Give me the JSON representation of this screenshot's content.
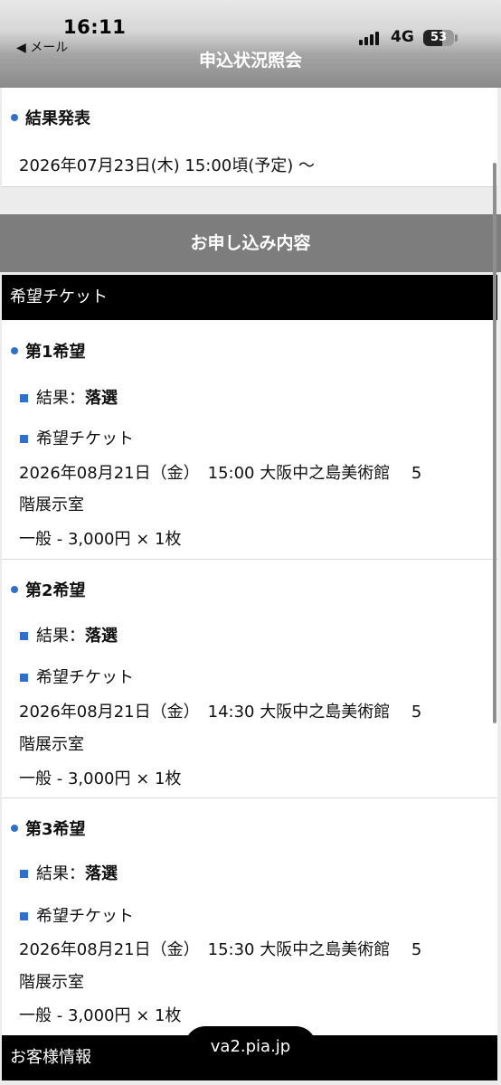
{
  "status_bar": {
    "time": "16:11",
    "back_label": "◀ メール",
    "network": "4G",
    "battery": "53"
  },
  "nav": {
    "title": "申込状況照会"
  },
  "result_announcement": {
    "heading": "結果発表",
    "date": "2026年07月23日(木) 15:00頃(予定) 〜"
  },
  "application": {
    "section_title": "お申し込み内容",
    "subsection_title": "希望チケット",
    "choices": [
      {
        "heading": "第1希望",
        "result_label": "結果：",
        "result_value": "落選",
        "ticket_label": "希望チケット",
        "ticket_line1": "2026年08月21日（金）　15:00  大阪中之島美術館　 5",
        "ticket_line2": "階展示室",
        "price": "一般 - 3,000円 × 1枚"
      },
      {
        "heading": "第2希望",
        "result_label": "結果：",
        "result_value": "落選",
        "ticket_label": "希望チケット",
        "ticket_line1": "2026年08月21日（金）　14:30  大阪中之島美術館　 5",
        "ticket_line2": "階展示室",
        "price": "一般 - 3,000円 × 1枚"
      },
      {
        "heading": "第3希望",
        "result_label": "結果：",
        "result_value": "落選",
        "ticket_label": "希望チケット",
        "ticket_line1": "2026年08月21日（金）　15:30  大阪中之島美術館　 5",
        "ticket_line2": "階展示室",
        "price": "一般 - 3,000円 × 1枚"
      }
    ]
  },
  "customer_info": {
    "title": "お客様情報"
  },
  "browser": {
    "url": "va2.pia.jp"
  }
}
